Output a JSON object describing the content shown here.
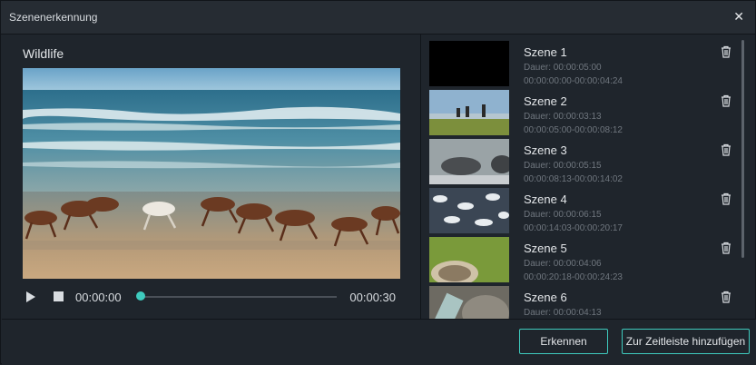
{
  "dialog": {
    "title": "Szenenerkennung"
  },
  "player": {
    "video_name": "Wildlife",
    "current_time": "00:00:00",
    "total_time": "00:00:30",
    "progress": 0.0
  },
  "scenes": [
    {
      "title": "Szene 1",
      "duration": "Dauer: 00:00:05:00",
      "range": "00:00:00:00-00:00:04:24"
    },
    {
      "title": "Szene 2",
      "duration": "Dauer: 00:00:03:13",
      "range": "00:00:05:00-00:00:08:12"
    },
    {
      "title": "Szene 3",
      "duration": "Dauer: 00:00:05:15",
      "range": "00:00:08:13-00:00:14:02"
    },
    {
      "title": "Szene 4",
      "duration": "Dauer: 00:00:06:15",
      "range": "00:00:14:03-00:00:20:17"
    },
    {
      "title": "Szene 5",
      "duration": "Dauer: 00:00:04:06",
      "range": "00:00:20:18-00:00:24:23"
    },
    {
      "title": "Szene 6",
      "duration": "Dauer: 00:00:04:13",
      "range": ""
    }
  ],
  "buttons": {
    "detect": "Erkennen",
    "add_to_timeline": "Zur Zeitleiste hinzufügen"
  },
  "icons": {
    "close": "close-icon",
    "play": "play-icon",
    "stop": "stop-icon",
    "delete": "trash-icon"
  },
  "colors": {
    "accent": "#3ecbbe",
    "background": "#1f252c"
  }
}
